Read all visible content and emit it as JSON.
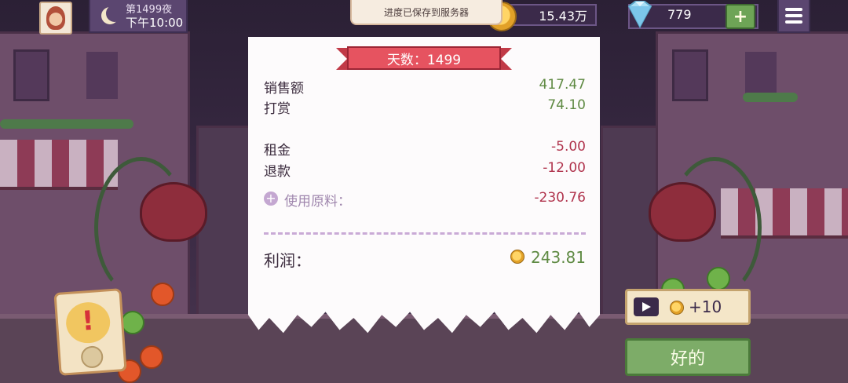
{
  "top_bar": {
    "night_label": "第1499夜",
    "time_label": "下午10:00",
    "toast": "进度已保存到服务器",
    "coins": "15.43万",
    "gems": "779",
    "add_label": "+"
  },
  "receipt": {
    "banner": "天数：1499",
    "income": [
      {
        "label": "销售额",
        "value": "417.47"
      },
      {
        "label": "打赏",
        "value": "74.10"
      }
    ],
    "expenses": [
      {
        "label": "租金",
        "value": "-5.00"
      },
      {
        "label": "退款",
        "value": "-12.00"
      }
    ],
    "ingredients": {
      "icon": "+",
      "label": "使用原料：",
      "value": "-230.76"
    },
    "profit": {
      "label": "利润：",
      "value": "243.81"
    }
  },
  "actions": {
    "ad_reward": "+10",
    "ok_label": "好的"
  },
  "colors": {
    "positive": "#5f8a43",
    "negative": "#b0344d",
    "banner": "#e65360",
    "ok_button": "#7dac68"
  }
}
